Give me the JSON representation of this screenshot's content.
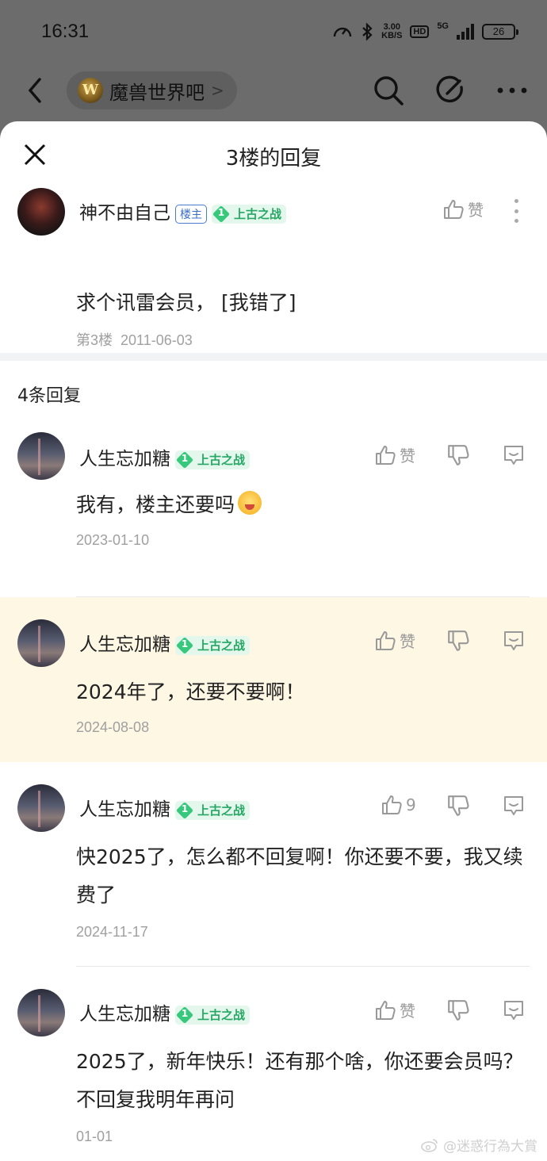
{
  "status_bar": {
    "time": "16:31",
    "speed_value": "3.00",
    "speed_unit": "KB/S",
    "hd": "HD",
    "network": "5G",
    "battery": "26"
  },
  "nav": {
    "forum_logo": "W",
    "forum_name": "魔兽世界吧",
    "forum_chevron": ">"
  },
  "sheet": {
    "title": "3楼的回复"
  },
  "main_post": {
    "author": "神不由自己",
    "op_tag": "楼主",
    "level": "1",
    "level_title": "上古之战",
    "like_label": "赞",
    "content": "求个讯雷会员， [我错了]",
    "floor": "第3楼",
    "date": "2011-06-03"
  },
  "reply_count": "4条回复",
  "replies": [
    {
      "author": "人生忘加糖",
      "level": "1",
      "level_title": "上古之战",
      "like_label": "赞",
      "content": "我有，楼主还要吗",
      "date": "2023-01-10"
    },
    {
      "author": "人生忘加糖",
      "level": "1",
      "level_title": "上古之战",
      "like_label": "赞",
      "content": "2024年了，还要不要啊！",
      "date": "2024-08-08"
    },
    {
      "author": "人生忘加糖",
      "level": "1",
      "level_title": "上古之战",
      "like_label": "9",
      "content": "快2025了，怎么都不回复啊！你还要不要，我又续费了",
      "date": "2024-11-17"
    },
    {
      "author": "人生忘加糖",
      "level": "1",
      "level_title": "上古之战",
      "like_label": "赞",
      "content": "2025了，新年快乐！还有那个啥，你还要会员吗？不回复我明年再问",
      "date": "01-01"
    }
  ],
  "watermark": "@迷惑行為大賞",
  "icons": {
    "back": "chevron-left-icon",
    "search": "search-icon",
    "edit": "edit-icon",
    "more": "more-icon",
    "close": "close-icon",
    "like": "thumbs-up-icon",
    "dislike": "thumbs-down-icon",
    "reply": "comment-icon"
  },
  "colors": {
    "level_green": "#26a864",
    "op_tag_blue": "#3a6fcc",
    "highlight_bg": "#fdf7e4",
    "overlay_gray": "#6c6c6c"
  }
}
